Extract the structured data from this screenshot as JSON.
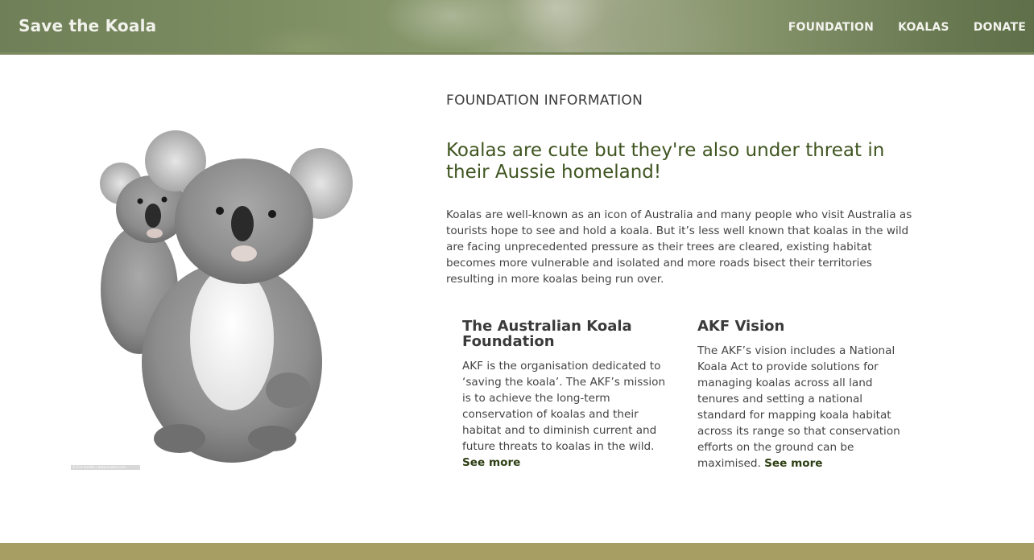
{
  "header": {
    "brand": "Save the Koala",
    "nav": [
      {
        "label": "FOUNDATION"
      },
      {
        "label": "KOALAS"
      },
      {
        "label": "DONATE"
      }
    ]
  },
  "main": {
    "image_credit": "© Eric Isselée / www.isselee.com",
    "eyebrow": "FOUNDATION INFORMATION",
    "headline": "Koalas are cute but they're also under threat in their Aussie homeland!",
    "intro": "Koalas are well-known as an icon of Australia and many people who visit Australia as tourists hope to see and hold a koala. But it’s less well known that koalas in the wild are facing unprecedented pressure as their trees are cleared, existing habitat becomes more vulnerable and isolated and more roads bisect their territories resulting in more koalas being run over.",
    "columns": [
      {
        "title": "The Australian Koala Foundation",
        "text": "AKF is the organisation dedicated to ‘saving the koala’. The AKF’s mission is to achieve the long-term conservation of koalas and their habitat and to diminish current and future threats to koalas in the wild.",
        "link": "See more"
      },
      {
        "title": "AKF Vision",
        "text": "The AKF’s vision includes a National Koala Act to provide solutions for managing koalas across all land tenures and setting a national standard for mapping koala habitat across its range so that conservation efforts on the ground can be maximised.",
        "link": "See more"
      }
    ]
  },
  "colors": {
    "headline": "#3f5520",
    "footer": "#a69e63",
    "link": "#2e3f14"
  }
}
